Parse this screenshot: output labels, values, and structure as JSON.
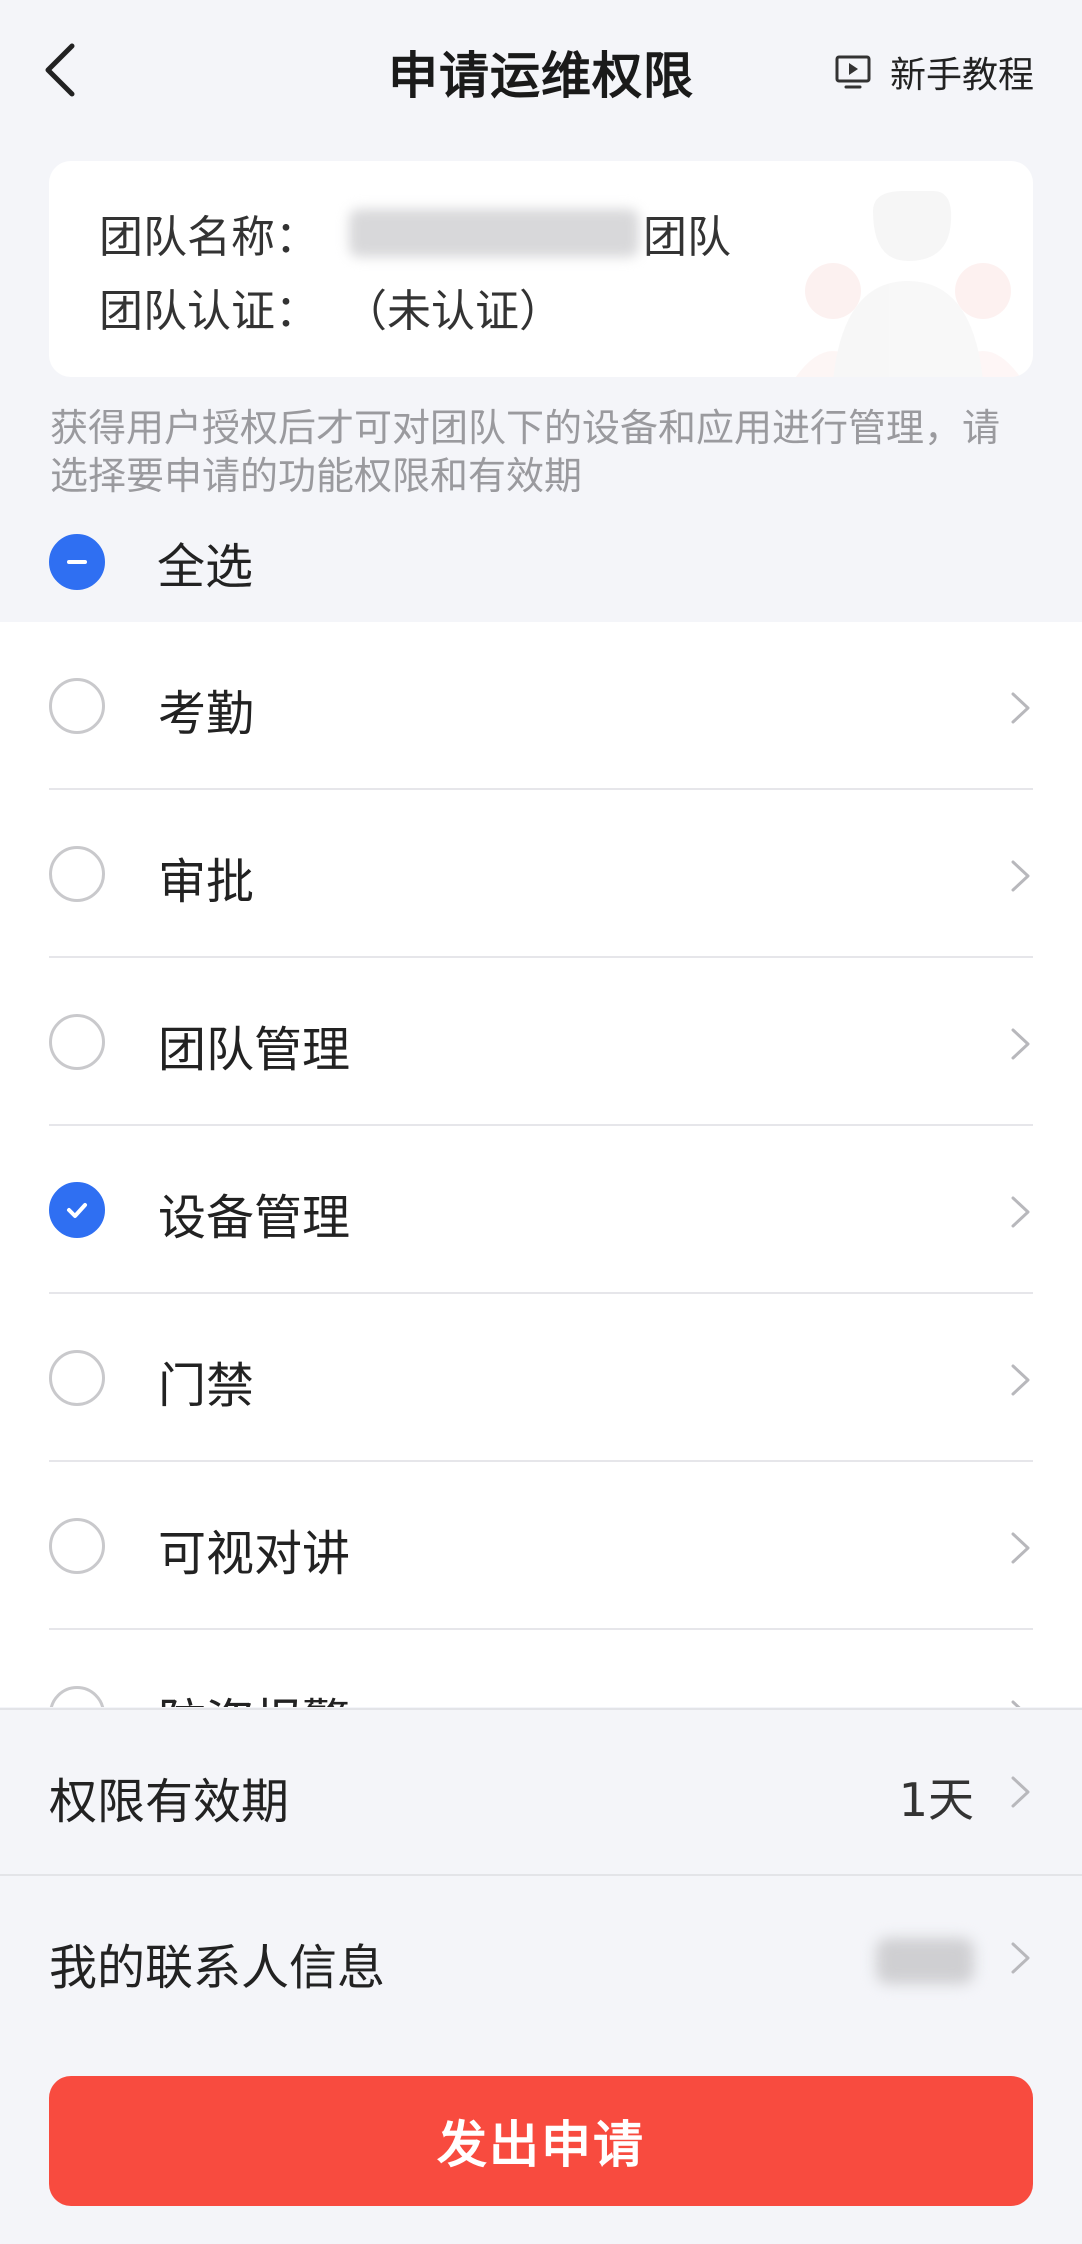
{
  "header": {
    "title": "申请运维权限",
    "tutorial_label": "新手教程"
  },
  "team": {
    "name_label": "团队名称：",
    "name_suffix": "团队",
    "cert_label": "团队认证：",
    "cert_value": "（未认证）"
  },
  "description": "获得用户授权后才可对团队下的设备和应用进行管理，请选择要申请的功能权限和有效期",
  "select_all": {
    "label": "全选",
    "state": "partial"
  },
  "permissions": [
    {
      "label": "考勤",
      "checked": false
    },
    {
      "label": "审批",
      "checked": false
    },
    {
      "label": "团队管理",
      "checked": false
    },
    {
      "label": "设备管理",
      "checked": true
    },
    {
      "label": "门禁",
      "checked": false
    },
    {
      "label": "可视对讲",
      "checked": false
    },
    {
      "label": "防盗报警",
      "checked": false
    }
  ],
  "validity": {
    "label": "权限有效期",
    "value": "1天"
  },
  "contact": {
    "label": "我的联系人信息"
  },
  "submit_label": "发出申请",
  "colors": {
    "accent": "#2f6ff2",
    "submit": "#f84b3f",
    "background": "#f4f5f9"
  }
}
